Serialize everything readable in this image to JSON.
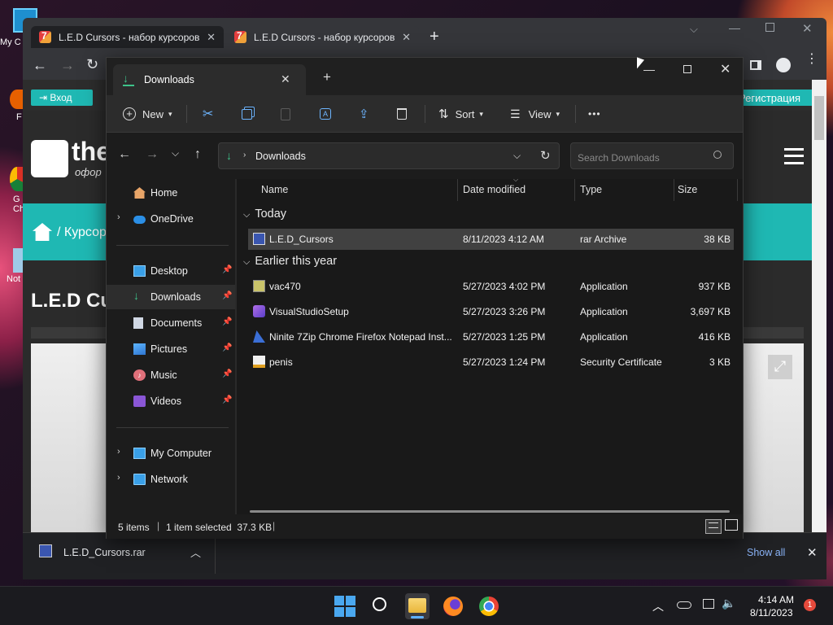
{
  "desktop": {
    "icons": [
      {
        "label": "My C",
        "icon": "computer-icon"
      },
      {
        "label": "F",
        "icon": "firefox-icon"
      },
      {
        "label": "G Ch",
        "icon": "chrome-icon"
      },
      {
        "label": "Not",
        "icon": "notepad-icon"
      }
    ]
  },
  "browser": {
    "tabs": [
      {
        "label": "L.E.D Cursors - набор курсоров",
        "close": "✕"
      },
      {
        "label": "L.E.D Cursors - набор курсоров",
        "close": "✕"
      }
    ],
    "new_tab": "+",
    "page": {
      "login_label": "Вход",
      "register_label": "Регистрация",
      "logo_text": "the",
      "logo_sub": "офор",
      "breadcrumb": "/ Курсор",
      "heading": "L.E.D Cu"
    },
    "download": {
      "filename": "L.E.D_Cursors.rar",
      "show_all": "Show all",
      "close": "✕"
    }
  },
  "explorer": {
    "tab_title": "Downloads",
    "toolbar": {
      "new": "New",
      "sort": "Sort",
      "view": "View",
      "more": "•••"
    },
    "address": {
      "path": "Downloads",
      "search_placeholder": "Search Downloads"
    },
    "nav": {
      "items": [
        {
          "label": "Home",
          "icon": "home-icon"
        },
        {
          "label": "OneDrive",
          "icon": "onedrive-icon"
        },
        {
          "label": "Desktop",
          "icon": "desktop-icon",
          "pinned": true
        },
        {
          "label": "Downloads",
          "icon": "downloads-icon",
          "pinned": true,
          "selected": true
        },
        {
          "label": "Documents",
          "icon": "documents-icon",
          "pinned": true
        },
        {
          "label": "Pictures",
          "icon": "pictures-icon",
          "pinned": true
        },
        {
          "label": "Music",
          "icon": "music-icon",
          "pinned": true
        },
        {
          "label": "Videos",
          "icon": "videos-icon",
          "pinned": true
        },
        {
          "label": "My Computer",
          "icon": "computer-icon"
        },
        {
          "label": "Network",
          "icon": "network-icon"
        }
      ]
    },
    "columns": {
      "name": "Name",
      "date": "Date modified",
      "type": "Type",
      "size": "Size"
    },
    "groups": [
      {
        "label": "Today",
        "files": [
          {
            "name": "L.E.D_Cursors",
            "date": "8/11/2023 4:12 AM",
            "type": "rar Archive",
            "size": "38 KB",
            "selected": true
          }
        ]
      },
      {
        "label": "Earlier this year",
        "files": [
          {
            "name": "vac470",
            "date": "5/27/2023 4:02 PM",
            "type": "Application",
            "size": "937 KB"
          },
          {
            "name": "VisualStudioSetup",
            "date": "5/27/2023 3:26 PM",
            "type": "Application",
            "size": "3,697 KB"
          },
          {
            "name": "Ninite 7Zip Chrome Firefox Notepad Inst...",
            "date": "5/27/2023 1:25 PM",
            "type": "Application",
            "size": "416 KB"
          },
          {
            "name": "penis",
            "date": "5/27/2023 1:24 PM",
            "type": "Security Certificate",
            "size": "3 KB"
          }
        ]
      }
    ],
    "status": {
      "count": "5 items",
      "selection": "1 item selected  37.3 KB"
    }
  },
  "taskbar": {
    "time": "4:14 AM",
    "date": "8/11/2023",
    "notification_count": "1"
  },
  "colors": {
    "accent_teal": "#1fb8b3",
    "explorer_bg": "#1f1f1f",
    "selection": "#414141",
    "link_blue": "#8ab4f8"
  }
}
